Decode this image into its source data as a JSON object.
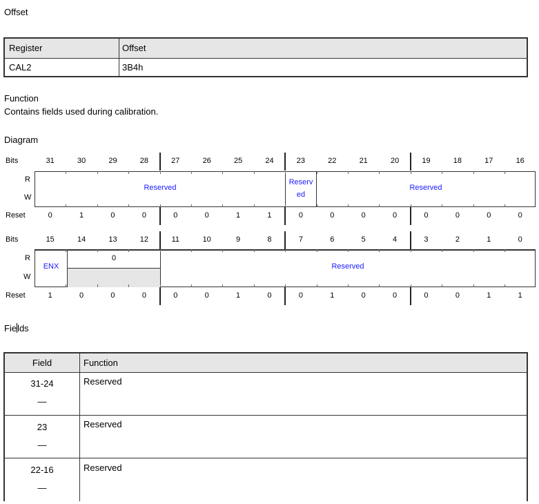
{
  "offset_heading": "Offset",
  "offset_table": {
    "headers": [
      "Register",
      "Offset"
    ],
    "row": [
      "CAL2",
      "3B4h"
    ]
  },
  "function_heading": "Function",
  "function_text": "Contains fields used during calibration.",
  "diagram_heading": "Diagram",
  "diagram": {
    "bits_label": "Bits",
    "r_label": "R",
    "w_label": "W",
    "reset_label": "Reset",
    "upper_bits": [
      "31",
      "30",
      "29",
      "28",
      "27",
      "26",
      "25",
      "24",
      "23",
      "22",
      "21",
      "20",
      "19",
      "18",
      "17",
      "16"
    ],
    "upper_reset": [
      "0",
      "1",
      "0",
      "0",
      "0",
      "0",
      "1",
      "1",
      "0",
      "0",
      "0",
      "0",
      "0",
      "0",
      "0",
      "0"
    ],
    "upper_fields": {
      "a": "Reserved",
      "b_line1": "Reserv",
      "b_line2": "ed",
      "c": "Reserved"
    },
    "lower_bits": [
      "15",
      "14",
      "13",
      "12",
      "11",
      "10",
      "9",
      "8",
      "7",
      "6",
      "5",
      "4",
      "3",
      "2",
      "1",
      "0"
    ],
    "lower_reset": [
      "1",
      "0",
      "0",
      "0",
      "0",
      "0",
      "1",
      "0",
      "0",
      "1",
      "0",
      "0",
      "0",
      "0",
      "1",
      "1"
    ],
    "lower_fields": {
      "enx": "ENX",
      "zero": "0",
      "reserved": "Reserved"
    }
  },
  "fields_heading_a": "Fie",
  "fields_heading_b": "ds",
  "fields_table": {
    "headers": [
      "Field",
      "Function"
    ],
    "rows": [
      {
        "field": "31-24",
        "dash": "—",
        "function": "Reserved"
      },
      {
        "field": "23",
        "dash": "—",
        "function": "Reserved"
      },
      {
        "field": "22-16",
        "dash": "—",
        "function": "Reserved"
      }
    ]
  }
}
